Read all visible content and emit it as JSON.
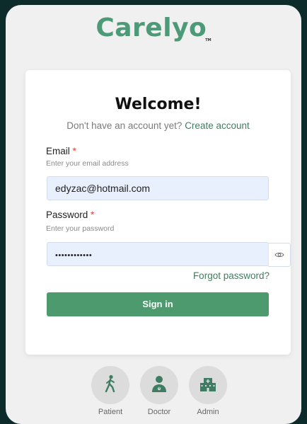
{
  "brand": {
    "name": "Carelyo",
    "tm": "TM"
  },
  "login": {
    "title": "Welcome!",
    "no_account_text": "Don't have an account yet?",
    "create_account_link": "Create account",
    "email": {
      "label": "Email",
      "required_mark": "*",
      "hint": "Enter your email address",
      "value": "edyzac@hotmail.com"
    },
    "password": {
      "label": "Password",
      "required_mark": "*",
      "hint": "Enter your password",
      "value": "••••••••••••"
    },
    "forgot_password": "Forgot password?",
    "sign_in": "Sign in"
  },
  "roles": [
    {
      "label": "Patient",
      "icon": "walking-person-icon"
    },
    {
      "label": "Doctor",
      "icon": "doctor-icon"
    },
    {
      "label": "Admin",
      "icon": "hospital-building-icon"
    }
  ],
  "colors": {
    "brand_green": "#4c9a77",
    "button_green": "#4c9a6e",
    "link_green": "#3e7f60",
    "required_red": "#e0413a",
    "input_fill": "#e8f0fd",
    "backdrop": "#0d2b2b"
  }
}
